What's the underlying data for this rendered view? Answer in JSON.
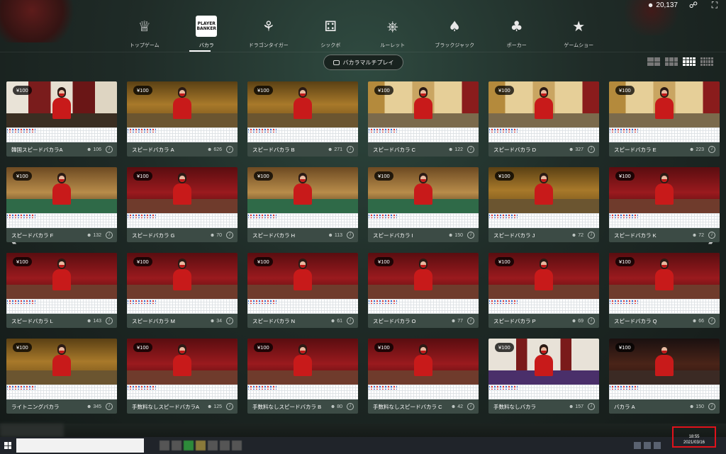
{
  "header": {
    "balance": "20,137",
    "categories": [
      {
        "label": "トップゲーム",
        "icon": "trophy-icon"
      },
      {
        "label": "バカラ",
        "icon": "player-banker-icon",
        "icon_text": "PLAYER\nBANKER",
        "active": true
      },
      {
        "label": "ドラゴンタイガー",
        "icon": "dragon-icon"
      },
      {
        "label": "シックボ",
        "icon": "dice-icon"
      },
      {
        "label": "ルーレット",
        "icon": "roulette-icon"
      },
      {
        "label": "ブラックジャック",
        "icon": "cards-icon"
      },
      {
        "label": "ポーカー",
        "icon": "poker-icon"
      },
      {
        "label": "ゲームショー",
        "icon": "game-show-icon"
      }
    ],
    "multiplay_label": "バカラマルチプレイ"
  },
  "tables": [
    {
      "bet": "¥100",
      "name": "韓国スピードバカラA",
      "players": "106",
      "theme": "ornate"
    },
    {
      "bet": "¥100",
      "name": "スピードバカラ A",
      "players": "626",
      "theme": "gold"
    },
    {
      "bet": "¥100",
      "name": "スピードバカラ B",
      "players": "271",
      "theme": "gold"
    },
    {
      "bet": "¥100",
      "name": "スピードバカラ C",
      "players": "122",
      "theme": "lattice"
    },
    {
      "bet": "¥100",
      "name": "スピードバカラ D",
      "players": "327",
      "theme": "lattice"
    },
    {
      "bet": "¥100",
      "name": "スピードバカラ E",
      "players": "223",
      "theme": "lattice"
    },
    {
      "bet": "¥100",
      "name": "スピードバカラ F",
      "players": "132",
      "theme": "green"
    },
    {
      "bet": "¥100",
      "name": "スピードバカラ G",
      "players": "70",
      "theme": "red"
    },
    {
      "bet": "¥100",
      "name": "スピードバカラ H",
      "players": "113",
      "theme": "green"
    },
    {
      "bet": "¥100",
      "name": "スピードバカラ I",
      "players": "150",
      "theme": "green"
    },
    {
      "bet": "¥100",
      "name": "スピードバカラ J",
      "players": "72",
      "theme": "gold"
    },
    {
      "bet": "¥100",
      "name": "スピードバカラ K",
      "players": "72",
      "theme": "red"
    },
    {
      "bet": "¥100",
      "name": "スピードバカラ L",
      "players": "143",
      "theme": "red"
    },
    {
      "bet": "¥100",
      "name": "スピードバカラ M",
      "players": "34",
      "theme": "red"
    },
    {
      "bet": "¥100",
      "name": "スピードバカラ N",
      "players": "61",
      "theme": "red"
    },
    {
      "bet": "¥100",
      "name": "スピードバカラ O",
      "players": "77",
      "theme": "red"
    },
    {
      "bet": "¥100",
      "name": "スピードバカラ P",
      "players": "69",
      "theme": "red"
    },
    {
      "bet": "¥100",
      "name": "スピードバカラ Q",
      "players": "66",
      "theme": "red"
    },
    {
      "bet": "¥100",
      "name": "ライトニングバカラ",
      "players": "345",
      "theme": "gold"
    },
    {
      "bet": "¥100",
      "name": "手数料なしスピードバカラA",
      "players": "125",
      "theme": "red"
    },
    {
      "bet": "¥100",
      "name": "手数料なしスピードバカラ B",
      "players": "80",
      "theme": "red"
    },
    {
      "bet": "¥100",
      "name": "手数料なしスピードバカラ C",
      "players": "42",
      "theme": "red"
    },
    {
      "bet": "¥100",
      "name": "手数料なしバカラ",
      "players": "157",
      "theme": "purple"
    },
    {
      "bet": "¥100",
      "name": "バカラ A",
      "players": "150",
      "theme": "dark"
    }
  ],
  "taskbar": {
    "time": "18:55",
    "date": "2021/03/16"
  },
  "colors": {
    "dealer_dress": "#c81a1a",
    "card_footer": "#3c4b45",
    "highlight_box": "#e0121b"
  }
}
